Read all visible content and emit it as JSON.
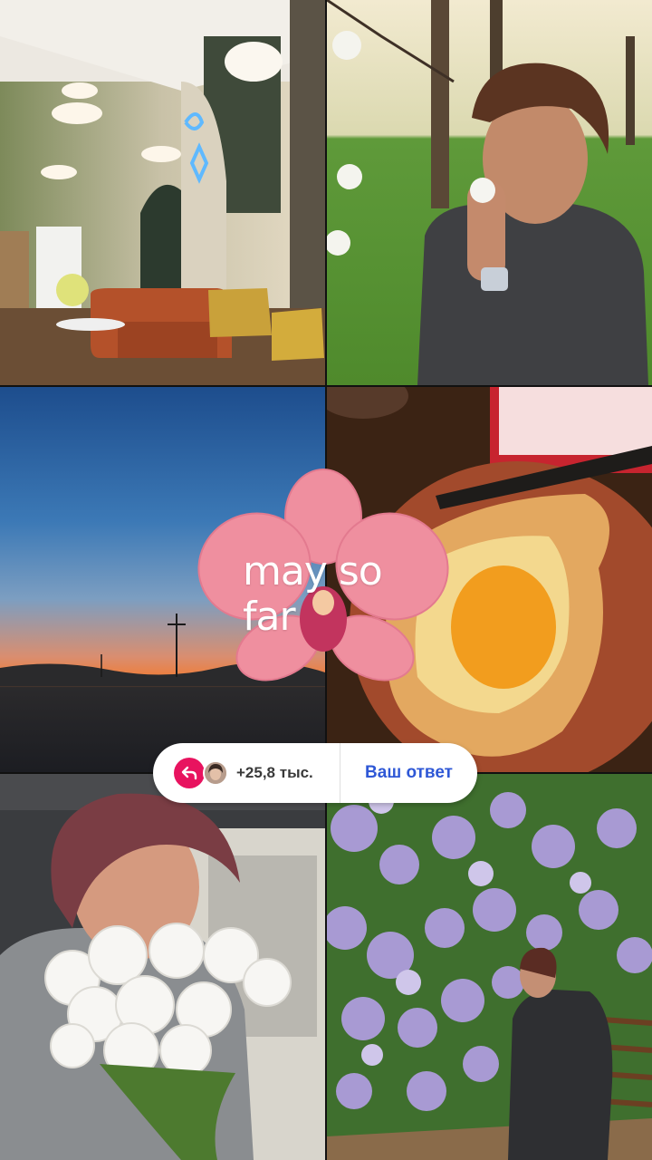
{
  "story": {
    "text": "may so far"
  },
  "reply_bar": {
    "reply_count": "+25,8 тыс.",
    "answer_label": "Ваш ответ"
  },
  "photos": [
    {
      "name": "salon-interior"
    },
    {
      "name": "woman-smelling-blossom"
    },
    {
      "name": "sunset-field"
    },
    {
      "name": "khachapuri-plate"
    },
    {
      "name": "woman-with-chrysanthemums"
    },
    {
      "name": "woman-under-lilacs"
    }
  ],
  "colors": {
    "reply_accent": "#e8135f",
    "answer_text": "#2f58d6"
  }
}
